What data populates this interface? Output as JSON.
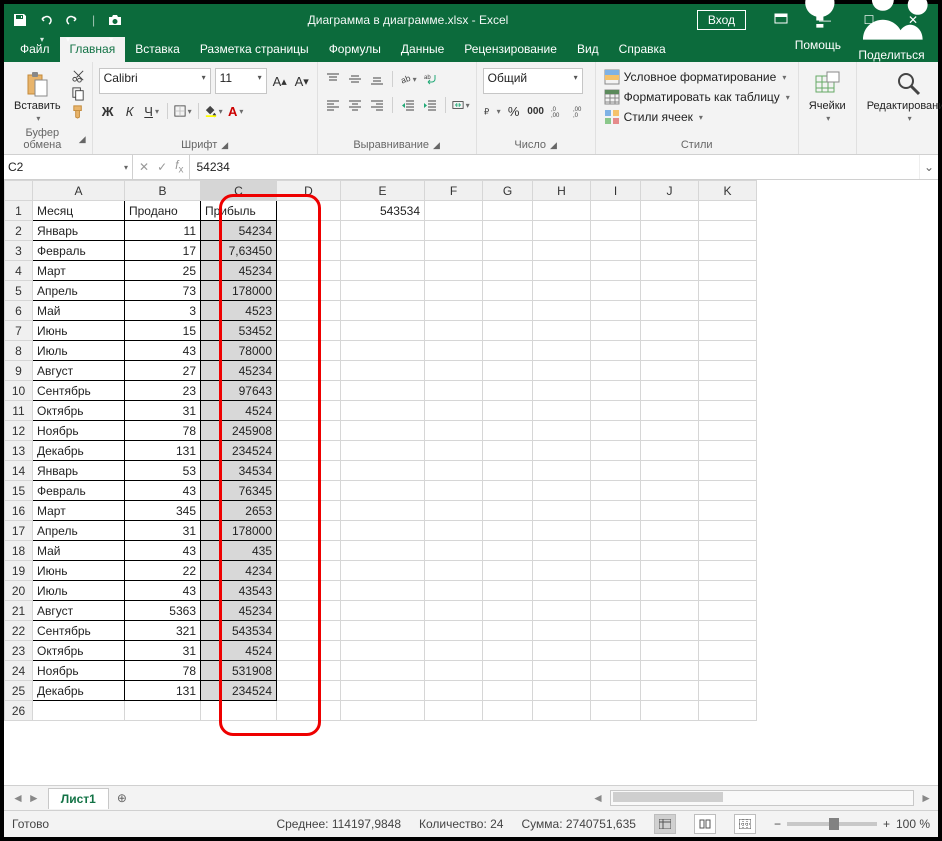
{
  "title": "Диаграмма в диаграмме.xlsx  -  Excel",
  "login": "Вход",
  "tabs": [
    "Файл",
    "Главная",
    "Вставка",
    "Разметка страницы",
    "Формулы",
    "Данные",
    "Рецензирование",
    "Вид",
    "Справка"
  ],
  "active_tab": "Главная",
  "help": "Помощь",
  "share": "Поделиться",
  "ribbon": {
    "clipboard": {
      "paste": "Вставить",
      "title": "Буфер обмена"
    },
    "font": {
      "name": "Calibri",
      "size": "11",
      "title": "Шрифт"
    },
    "align": {
      "title": "Выравнивание"
    },
    "number": {
      "format": "Общий",
      "title": "Число"
    },
    "styles": {
      "cond": "Условное форматирование",
      "table": "Форматировать как таблицу",
      "cell": "Стили ячеек",
      "title": "Стили"
    },
    "cells": {
      "title": "Ячейки"
    },
    "editing": {
      "title": "Редактирование"
    }
  },
  "namebox": "C2",
  "formula": "54234",
  "cols": [
    "A",
    "B",
    "C",
    "D",
    "E",
    "F",
    "G",
    "H",
    "I",
    "J",
    "K"
  ],
  "headers": {
    "A": "Месяц",
    "B": "Продано",
    "C": "Прибыль"
  },
  "e1": "543534",
  "rows": [
    {
      "r": 2,
      "a": "Январь",
      "b": "11",
      "c": "54234"
    },
    {
      "r": 3,
      "a": "Февраль",
      "b": "17",
      "c": "7,63450"
    },
    {
      "r": 4,
      "a": "Март",
      "b": "25",
      "c": "45234"
    },
    {
      "r": 5,
      "a": "Апрель",
      "b": "73",
      "c": "178000"
    },
    {
      "r": 6,
      "a": "Май",
      "b": "3",
      "c": "4523"
    },
    {
      "r": 7,
      "a": "Июнь",
      "b": "15",
      "c": "53452"
    },
    {
      "r": 8,
      "a": "Июль",
      "b": "43",
      "c": "78000"
    },
    {
      "r": 9,
      "a": "Август",
      "b": "27",
      "c": "45234"
    },
    {
      "r": 10,
      "a": "Сентябрь",
      "b": "23",
      "c": "97643"
    },
    {
      "r": 11,
      "a": "Октябрь",
      "b": "31",
      "c": "4524"
    },
    {
      "r": 12,
      "a": "Ноябрь",
      "b": "78",
      "c": "245908"
    },
    {
      "r": 13,
      "a": "Декабрь",
      "b": "131",
      "c": "234524"
    },
    {
      "r": 14,
      "a": "Январь",
      "b": "53",
      "c": "34534"
    },
    {
      "r": 15,
      "a": "Февраль",
      "b": "43",
      "c": "76345"
    },
    {
      "r": 16,
      "a": "Март",
      "b": "345",
      "c": "2653"
    },
    {
      "r": 17,
      "a": "Апрель",
      "b": "31",
      "c": "178000"
    },
    {
      "r": 18,
      "a": "Май",
      "b": "43",
      "c": "435"
    },
    {
      "r": 19,
      "a": "Июнь",
      "b": "22",
      "c": "4234"
    },
    {
      "r": 20,
      "a": "Июль",
      "b": "43",
      "c": "43543"
    },
    {
      "r": 21,
      "a": "Август",
      "b": "5363",
      "c": "45234"
    },
    {
      "r": 22,
      "a": "Сентябрь",
      "b": "321",
      "c": "543534"
    },
    {
      "r": 23,
      "a": "Октябрь",
      "b": "31",
      "c": "4524"
    },
    {
      "r": 24,
      "a": "Ноябрь",
      "b": "78",
      "c": "531908"
    },
    {
      "r": 25,
      "a": "Декабрь",
      "b": "131",
      "c": "234524"
    }
  ],
  "sheet": "Лист1",
  "status": {
    "ready": "Готово",
    "avg": "Среднее: 114197,9848",
    "count": "Количество: 24",
    "sum": "Сумма: 2740751,635",
    "zoom": "100 %"
  }
}
